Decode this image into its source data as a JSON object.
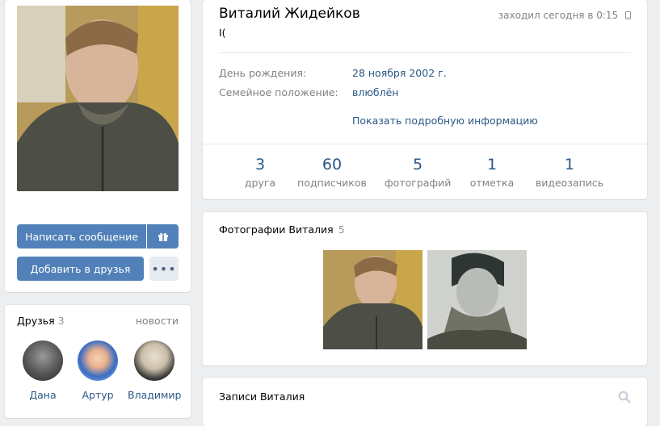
{
  "profile": {
    "name": "Виталий Жидейков",
    "status": "I(",
    "online": "заходил сегодня в 0:15",
    "info": [
      {
        "label": "День рождения:",
        "value": "28 ноября 2002 г."
      },
      {
        "label": "Семейное положение:",
        "value": "влюблён"
      }
    ],
    "more_info": "Показать подробную информацию",
    "counters": [
      {
        "num": "3",
        "label": "друга"
      },
      {
        "num": "60",
        "label": "подписчиков"
      },
      {
        "num": "5",
        "label": "фотографий"
      },
      {
        "num": "1",
        "label": "отметка"
      },
      {
        "num": "1",
        "label": "видеозапись"
      }
    ]
  },
  "actions": {
    "message_label": "Написать сообщение",
    "add_friend_label": "Добавить в друзья",
    "more_label": "•••"
  },
  "friends": {
    "title": "Друзья",
    "count": "3",
    "news_label": "новости",
    "items": [
      {
        "name": "Дана"
      },
      {
        "name": "Артур"
      },
      {
        "name": "Владимир"
      }
    ]
  },
  "photos": {
    "title": "Фотографии Виталия",
    "count": "5"
  },
  "posts": {
    "title": "Записи Виталия"
  },
  "colors": {
    "accent": "#5181b8",
    "link": "#2a5885",
    "muted": "#828282",
    "background": "#edeef0"
  }
}
